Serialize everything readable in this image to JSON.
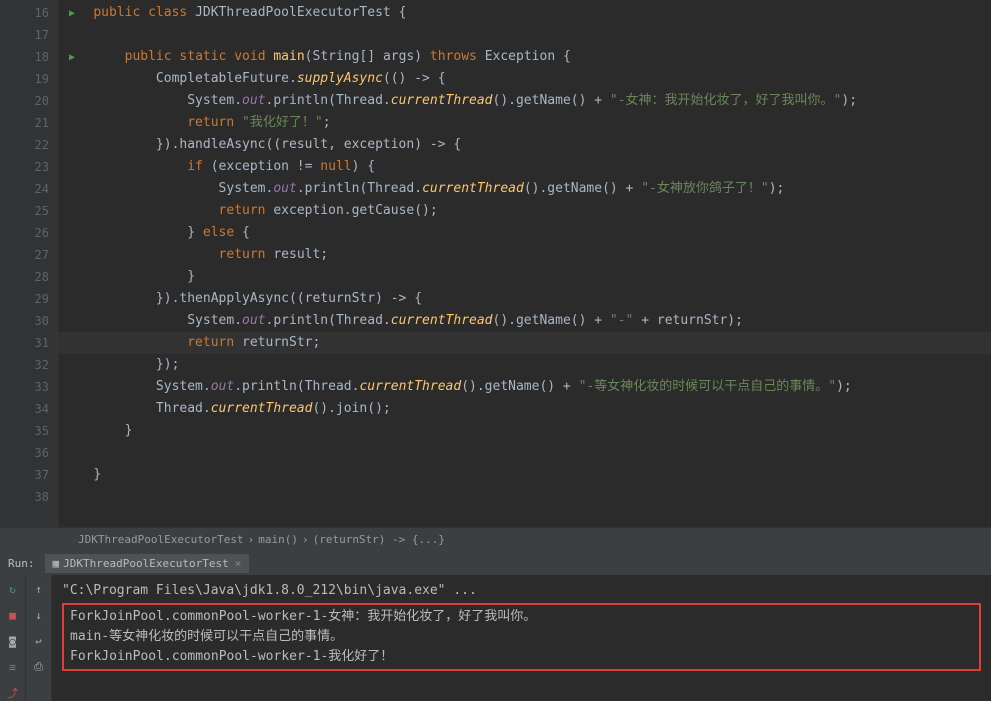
{
  "lines": {
    "start": 16,
    "end": 38
  },
  "code": {
    "l16": {
      "indent": "    ",
      "tokens": [
        [
          "kw",
          "public"
        ],
        [
          "plain",
          " "
        ],
        [
          "kw",
          "class"
        ],
        [
          "plain",
          " JDKThreadPoolExecutorTest {"
        ]
      ]
    },
    "l17": {
      "indent": "",
      "tokens": []
    },
    "l18": {
      "indent": "        ",
      "tokens": [
        [
          "kw",
          "public"
        ],
        [
          "plain",
          " "
        ],
        [
          "kw",
          "static"
        ],
        [
          "plain",
          " "
        ],
        [
          "kw",
          "void"
        ],
        [
          "plain",
          " "
        ],
        [
          "fn",
          "main"
        ],
        [
          "plain",
          "(String[] args) "
        ],
        [
          "kw",
          "throws"
        ],
        [
          "plain",
          " Exception {"
        ]
      ]
    },
    "l19": {
      "indent": "            ",
      "tokens": [
        [
          "plain",
          "CompletableFuture."
        ],
        [
          "static-method",
          "supplyAsync"
        ],
        [
          "plain",
          "(() -> {"
        ]
      ]
    },
    "l20": {
      "indent": "                ",
      "tokens": [
        [
          "plain",
          "System."
        ],
        [
          "static-field",
          "out"
        ],
        [
          "plain",
          ".println(Thread."
        ],
        [
          "static-method",
          "currentThread"
        ],
        [
          "plain",
          "().getName() + "
        ],
        [
          "str",
          "\"-女神：我开始化妆了，好了我叫你。\""
        ],
        [
          "plain",
          ");"
        ]
      ]
    },
    "l21": {
      "indent": "                ",
      "tokens": [
        [
          "kw",
          "return"
        ],
        [
          "plain",
          " "
        ],
        [
          "str",
          "\"我化好了！\""
        ],
        [
          "plain",
          ";"
        ]
      ]
    },
    "l22": {
      "indent": "            ",
      "tokens": [
        [
          "plain",
          "}).handleAsync((result, exception) -> {"
        ]
      ]
    },
    "l23": {
      "indent": "                ",
      "tokens": [
        [
          "kw",
          "if"
        ],
        [
          "plain",
          " (exception != "
        ],
        [
          "kw",
          "null"
        ],
        [
          "plain",
          ") {"
        ]
      ]
    },
    "l24": {
      "indent": "                    ",
      "tokens": [
        [
          "plain",
          "System."
        ],
        [
          "static-field",
          "out"
        ],
        [
          "plain",
          ".println(Thread."
        ],
        [
          "static-method",
          "currentThread"
        ],
        [
          "plain",
          "().getName() + "
        ],
        [
          "str",
          "\"-女神放你鸽子了！\""
        ],
        [
          "plain",
          ");"
        ]
      ]
    },
    "l25": {
      "indent": "                    ",
      "tokens": [
        [
          "kw",
          "return"
        ],
        [
          "plain",
          " exception.getCause();"
        ]
      ]
    },
    "l26": {
      "indent": "                ",
      "tokens": [
        [
          "plain",
          "} "
        ],
        [
          "kw",
          "else"
        ],
        [
          "plain",
          " {"
        ]
      ]
    },
    "l27": {
      "indent": "                    ",
      "tokens": [
        [
          "kw",
          "return"
        ],
        [
          "plain",
          " result;"
        ]
      ]
    },
    "l28": {
      "indent": "                ",
      "tokens": [
        [
          "plain",
          "}"
        ]
      ]
    },
    "l29": {
      "indent": "            ",
      "tokens": [
        [
          "plain",
          "}).thenApplyAsync((returnStr) -> {"
        ]
      ]
    },
    "l30": {
      "indent": "                ",
      "tokens": [
        [
          "plain",
          "System."
        ],
        [
          "static-field",
          "out"
        ],
        [
          "plain",
          ".println(Thread."
        ],
        [
          "static-method",
          "currentThread"
        ],
        [
          "plain",
          "().getName() + "
        ],
        [
          "str",
          "\"-\""
        ],
        [
          "plain",
          " + returnStr);"
        ]
      ]
    },
    "l31": {
      "indent": "                ",
      "tokens": [
        [
          "kw",
          "return"
        ],
        [
          "plain",
          " returnStr;"
        ]
      ]
    },
    "l32": {
      "indent": "            ",
      "tokens": [
        [
          "plain",
          "});"
        ]
      ]
    },
    "l33": {
      "indent": "            ",
      "tokens": [
        [
          "plain",
          "System."
        ],
        [
          "static-field",
          "out"
        ],
        [
          "plain",
          ".println(Thread."
        ],
        [
          "static-method",
          "currentThread"
        ],
        [
          "plain",
          "().getName() + "
        ],
        [
          "str",
          "\"-等女神化妆的时候可以干点自己的事情。\""
        ],
        [
          "plain",
          ");"
        ]
      ]
    },
    "l34": {
      "indent": "            ",
      "tokens": [
        [
          "plain",
          "Thread."
        ],
        [
          "static-method",
          "currentThread"
        ],
        [
          "plain",
          "().join();"
        ]
      ]
    },
    "l35": {
      "indent": "        ",
      "tokens": [
        [
          "plain",
          "}"
        ]
      ]
    },
    "l36": {
      "indent": "",
      "tokens": []
    },
    "l37": {
      "indent": "    ",
      "tokens": [
        [
          "plain",
          "}"
        ]
      ]
    },
    "l38": {
      "indent": "",
      "tokens": []
    }
  },
  "runIcons": [
    16,
    18
  ],
  "highlightedLine": 31,
  "breadcrumb": {
    "part1": "JDKThreadPoolExecutorTest",
    "sep": "›",
    "part2": "main()",
    "part3": "(returnStr) -> {...}"
  },
  "runPanel": {
    "label": "Run:",
    "tabName": "JDKThreadPoolExecutorTest",
    "console": {
      "path": "\"C:\\Program Files\\Java\\jdk1.8.0_212\\bin\\java.exe\" ...",
      "line1": "ForkJoinPool.commonPool-worker-1-女神：我开始化妆了，好了我叫你。",
      "line2": "main-等女神化妆的时候可以干点自己的事情。",
      "line3": "ForkJoinPool.commonPool-worker-1-我化好了！"
    }
  }
}
